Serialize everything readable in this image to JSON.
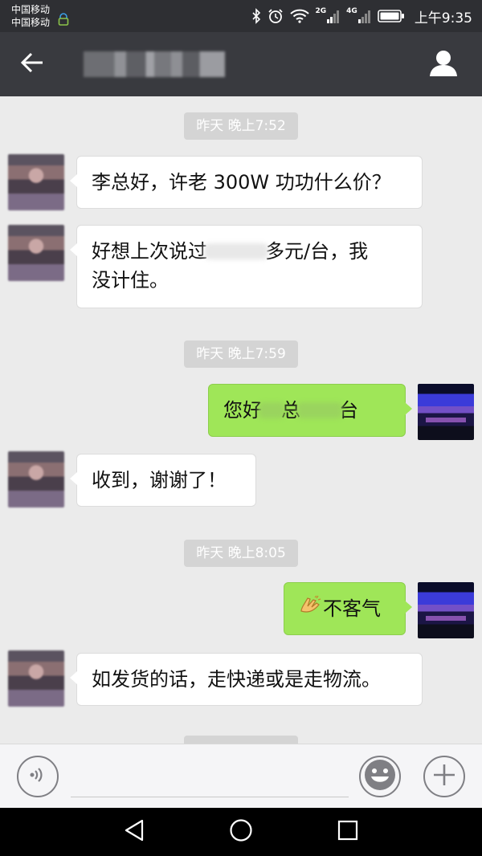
{
  "status_bar": {
    "carrier_1": "中国移动",
    "carrier_2": "中国移动",
    "net_2g": "2G",
    "net_4g": "4G",
    "time": "上午9:35",
    "icons": [
      "lock-icon",
      "bluetooth-icon",
      "alarm-icon",
      "wifi-icon",
      "signal-icon",
      "battery-icon"
    ]
  },
  "header": {
    "title": "",
    "back_icon": "arrow-left-icon",
    "profile_icon": "person-icon"
  },
  "timestamps": [
    "昨天 晚上7:52",
    "昨天 晚上7:59",
    "昨天 晚上8:05"
  ],
  "messages": [
    {
      "from": "other",
      "text": "李总好，许老 300W 功功什么价？"
    },
    {
      "from": "other",
      "line1_a": "好想上次说过",
      "line1_b": "多元/台，我",
      "line2": "没计住。"
    },
    {
      "from": "self",
      "part_a": "您好",
      "part_b": "总",
      "part_c": "台"
    },
    {
      "from": "other",
      "text": "收到，谢谢了！"
    },
    {
      "from": "self",
      "text": "不客气",
      "emoji": "clap-emoji"
    },
    {
      "from": "other",
      "text": "如发货的话，走快递或是走物流。"
    }
  ],
  "input_bar": {
    "voice_icon": "voice-icon",
    "placeholder": "",
    "emoji_icon": "smiley-icon",
    "more_icon": "plus-icon"
  },
  "colors": {
    "status_bar": "#2e2f33",
    "title_bar": "#393a3f",
    "chat_bg": "#ebebeb",
    "bubble_in": "#ffffff",
    "bubble_out": "#9fe658"
  }
}
